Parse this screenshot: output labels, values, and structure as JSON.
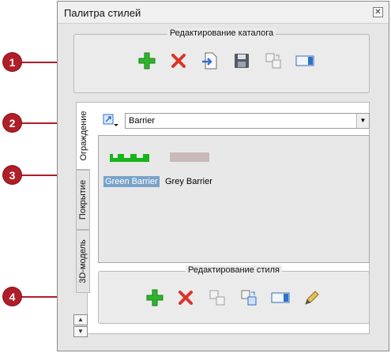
{
  "window": {
    "title": "Палитра стилей",
    "close_glyph": "✕"
  },
  "catalog_group": {
    "title": "Редактирование каталога",
    "tools": [
      "add-icon",
      "delete-icon",
      "import-icon",
      "save-icon",
      "copy-icon",
      "rename-icon"
    ]
  },
  "tabs": [
    {
      "label": "Ограждение",
      "active": true
    },
    {
      "label": "Покрытие",
      "active": false
    },
    {
      "label": "3D-модель",
      "active": false
    }
  ],
  "combo": {
    "value": "Barrier"
  },
  "styles": [
    {
      "label": "Green Barrier",
      "selected": true,
      "swatch": "#19b419"
    },
    {
      "label": "Grey Barrier",
      "selected": false,
      "swatch": "#c9b9b9"
    }
  ],
  "style_group": {
    "title": "Редактирование стиля",
    "tools": [
      "add-icon",
      "delete-icon",
      "copy-icon",
      "paste-icon",
      "rename-icon",
      "edit-pencil-icon"
    ]
  },
  "callouts": [
    "1",
    "2",
    "3",
    "4"
  ],
  "colors": {
    "callout": "#b01e28",
    "add_green": "#2db52d",
    "delete_red": "#d9342b",
    "selection": "#7aa3c9"
  },
  "scroll": {
    "up": "▲",
    "down": "▼"
  }
}
